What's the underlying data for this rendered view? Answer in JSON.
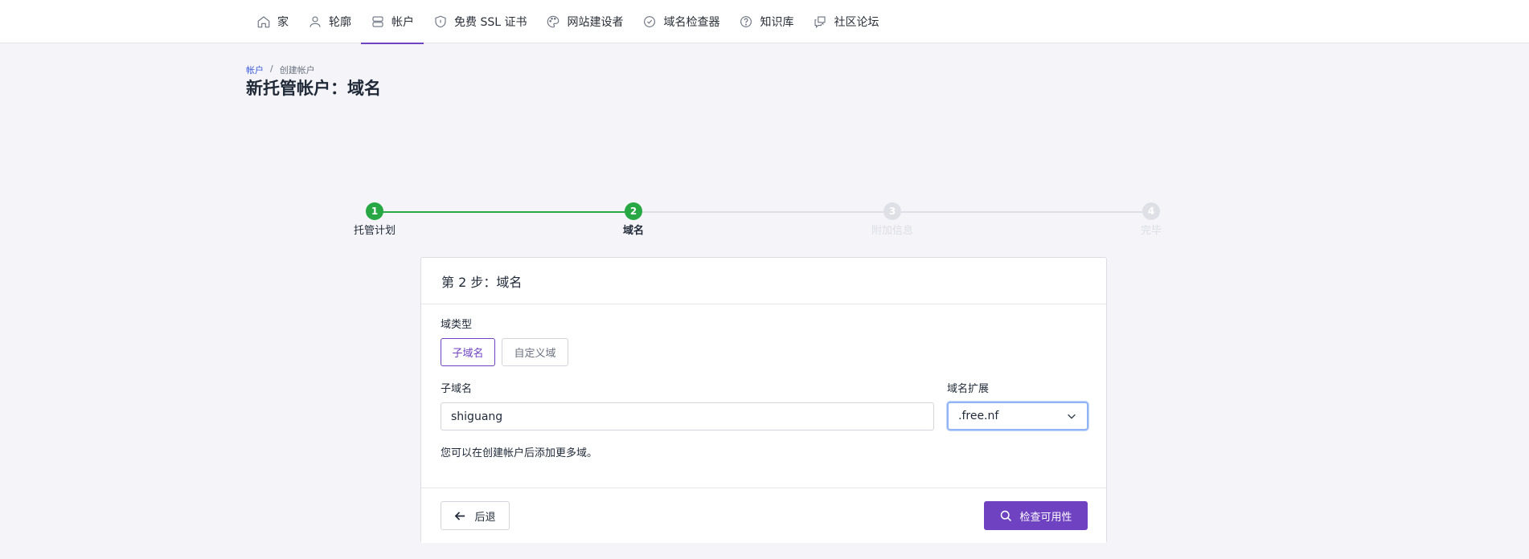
{
  "nav": {
    "items": [
      {
        "label": "家",
        "icon": "home-icon"
      },
      {
        "label": "轮廓",
        "icon": "user-icon"
      },
      {
        "label": "帐户",
        "icon": "server-icon",
        "active": true
      },
      {
        "label": "免费 SSL 证书",
        "icon": "shield-icon"
      },
      {
        "label": "网站建设者",
        "icon": "palette-icon"
      },
      {
        "label": "域名检查器",
        "icon": "check-circle-icon"
      },
      {
        "label": "知识库",
        "icon": "question-circle-icon"
      },
      {
        "label": "社区论坛",
        "icon": "chat-icon"
      }
    ]
  },
  "breadcrumb": {
    "root": "帐户",
    "separator": "/",
    "current": "创建帐户"
  },
  "page": {
    "title": "新托管帐户：域名"
  },
  "stepper": {
    "steps": [
      {
        "number": "1",
        "label": "托管计划",
        "state": "done"
      },
      {
        "number": "2",
        "label": "域名",
        "state": "current"
      },
      {
        "number": "3",
        "label": "附加信息",
        "state": "todo"
      },
      {
        "number": "4",
        "label": "完毕",
        "state": "todo"
      }
    ]
  },
  "card": {
    "header": "第 2 步：域名",
    "domain_type_label": "域类型",
    "domain_type_options": [
      {
        "label": "子域名",
        "selected": true
      },
      {
        "label": "自定义域",
        "selected": false
      }
    ],
    "subdomain_label": "子域名",
    "subdomain_value": "shiguang",
    "extension_label": "域名扩展",
    "extension_value": ".free.nf",
    "help_text": "您可以在创建帐户后添加更多域。",
    "back_label": "后退",
    "check_label": "检查可用性"
  },
  "colors": {
    "accent": "#6f42c1",
    "success": "#28a745",
    "inactive_step": "#dfe0e6",
    "link": "#3b5bdb",
    "background": "#f5f5f9"
  }
}
